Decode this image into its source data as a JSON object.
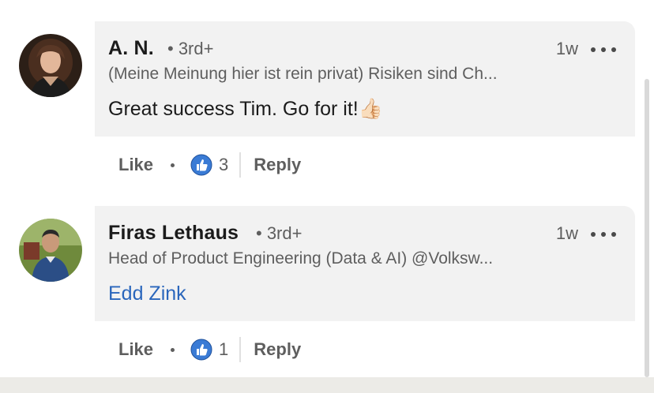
{
  "comments": [
    {
      "name": "A. N.",
      "degree": "• 3rd+",
      "time": "1w",
      "headline": "(Meine Meinung hier ist rein privat) Risiken sind Ch...",
      "text": "Great success Tim. Go for it!",
      "emoji": "👍🏻",
      "like_label": "Like",
      "reaction_count": "3",
      "reply_label": "Reply"
    },
    {
      "name": "Firas Lethaus",
      "degree": "• 3rd+",
      "time": "1w",
      "headline": "Head of Product Engineering (Data & AI) @Volksw...",
      "mention": "Edd Zink",
      "like_label": "Like",
      "reaction_count": "1",
      "reply_label": "Reply"
    }
  ],
  "colors": {
    "bubble": "#f2f2f2",
    "mention": "#2a66bc",
    "like_blue": "#3a7bd5"
  }
}
